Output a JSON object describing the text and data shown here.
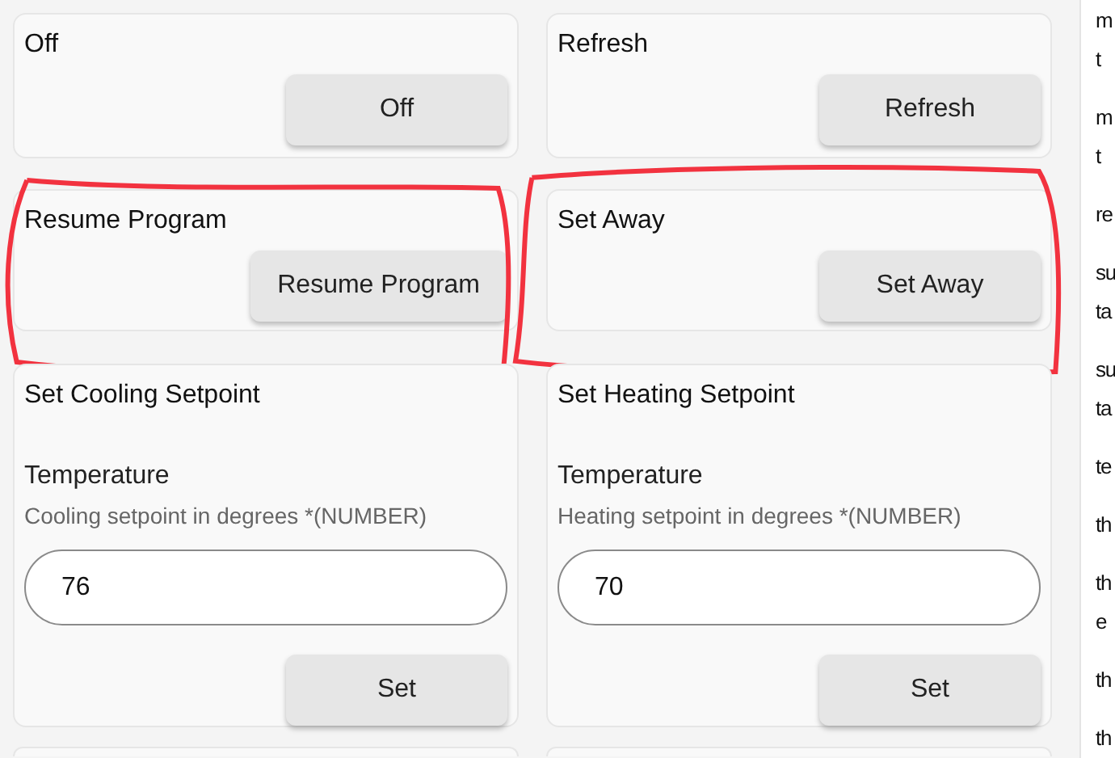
{
  "cards": [
    {
      "kind": "button",
      "title": "Off",
      "button": "Off",
      "circled": false
    },
    {
      "kind": "button",
      "title": "Refresh",
      "button": "Refresh",
      "circled": false
    },
    {
      "kind": "button",
      "title": "Resume Program",
      "button": "Resume Program",
      "circled": true
    },
    {
      "kind": "button",
      "title": "Set Away",
      "button": "Set Away",
      "circled": true
    },
    {
      "kind": "input",
      "title": "Set Cooling Setpoint",
      "field_label": "Temperature",
      "description": "Cooling setpoint in degrees *(NUMBER)",
      "value": "76",
      "button": "Set",
      "circled": false
    },
    {
      "kind": "input",
      "title": "Set Heating Setpoint",
      "field_label": "Temperature",
      "description": "Heating setpoint in degrees *(NUMBER)",
      "value": "70",
      "button": "Set",
      "circled": false
    }
  ],
  "side_panel": {
    "entries": [
      {
        "lines": [
          "m",
          "t"
        ]
      },
      {
        "lines": [
          "m",
          "t"
        ]
      },
      {
        "lines": [
          "re"
        ]
      },
      {
        "lines": [
          "su",
          "ta"
        ]
      },
      {
        "lines": [
          "su",
          "ta"
        ]
      },
      {
        "lines": [
          "te"
        ]
      },
      {
        "lines": [
          "th"
        ]
      },
      {
        "lines": [
          "th",
          "e"
        ]
      },
      {
        "lines": [
          "th"
        ]
      },
      {
        "lines": [
          "th"
        ]
      }
    ]
  }
}
